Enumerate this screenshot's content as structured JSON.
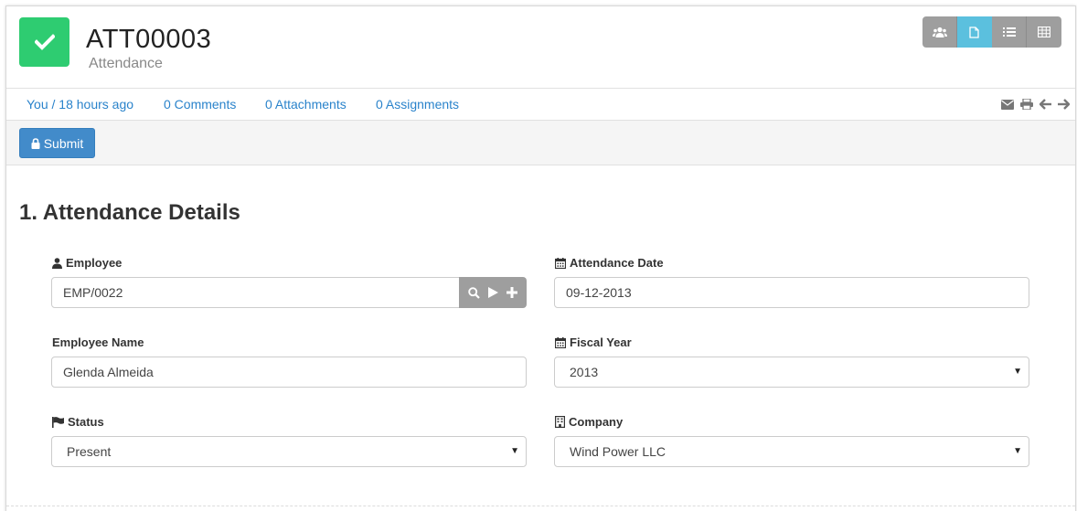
{
  "header": {
    "title": "ATT00003",
    "subtitle": "Attendance",
    "status_icon": "check-icon",
    "status_color": "#2ecc71",
    "view_buttons": [
      {
        "icon": "group-icon",
        "active": false
      },
      {
        "icon": "document-icon",
        "active": true
      },
      {
        "icon": "list-icon",
        "active": false
      },
      {
        "icon": "table-icon",
        "active": false
      }
    ]
  },
  "meta": {
    "owner": "You / 18 hours ago",
    "comments": "0 Comments",
    "attachments": "0 Attachments",
    "assignments": "0 Assignments",
    "tools": [
      "email-icon",
      "print-icon",
      "arrow-left-icon",
      "arrow-right-icon"
    ]
  },
  "toolbar": {
    "submit_label": "Submit",
    "submit_color": "#428bca"
  },
  "section": {
    "title": "1. Attendance Details"
  },
  "fields": {
    "employee": {
      "label": "Employee",
      "value": "EMP/0022"
    },
    "employee_name": {
      "label": "Employee Name",
      "value": "Glenda Almeida"
    },
    "status": {
      "label": "Status",
      "value": "Present"
    },
    "attendance_date": {
      "label": "Attendance Date",
      "value": "09-12-2013"
    },
    "fiscal_year": {
      "label": "Fiscal Year",
      "value": "2013"
    },
    "company": {
      "label": "Company",
      "value": "Wind Power LLC"
    }
  },
  "link_color": "#2a83cb"
}
